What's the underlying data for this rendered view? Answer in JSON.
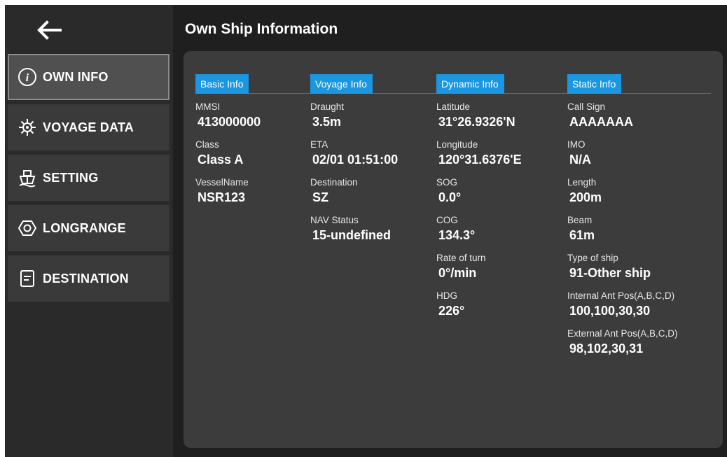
{
  "header": {
    "title": "Own Ship Information"
  },
  "sidebar": {
    "items": [
      {
        "label": "OWN INFO",
        "icon": "info-icon",
        "active": true
      },
      {
        "label": "VOYAGE DATA",
        "icon": "gear-icon",
        "active": false
      },
      {
        "label": "SETTING",
        "icon": "ship-icon",
        "active": false
      },
      {
        "label": "LONGRANGE",
        "icon": "hexagon-icon",
        "active": false
      },
      {
        "label": "DESTINATION",
        "icon": "document-icon",
        "active": false
      }
    ]
  },
  "sections": {
    "basic": {
      "title": "Basic Info",
      "fields": [
        {
          "label": "MMSI",
          "value": "413000000"
        },
        {
          "label": "Class",
          "value": "Class A"
        },
        {
          "label": "VesselName",
          "value": "NSR123"
        }
      ]
    },
    "voyage": {
      "title": "Voyage Info",
      "fields": [
        {
          "label": "Draught",
          "value": "3.5m"
        },
        {
          "label": "ETA",
          "value": "02/01 01:51:00"
        },
        {
          "label": "Destination",
          "value": "SZ"
        },
        {
          "label": "NAV Status",
          "value": "15-undefined"
        }
      ]
    },
    "dynamic": {
      "title": "Dynamic Info",
      "fields": [
        {
          "label": "Latitude",
          "value": "31°26.9326'N"
        },
        {
          "label": "Longitude",
          "value": "120°31.6376'E"
        },
        {
          "label": "SOG",
          "value": "0.0°"
        },
        {
          "label": "COG",
          "value": "134.3°"
        },
        {
          "label": "Rate of turn",
          "value": "0°/min"
        },
        {
          "label": "HDG",
          "value": "226°"
        }
      ]
    },
    "static": {
      "title": "Static Info",
      "fields": [
        {
          "label": "Call Sign",
          "value": "AAAAAAA"
        },
        {
          "label": "IMO",
          "value": "N/A"
        },
        {
          "label": "Length",
          "value": "200m"
        },
        {
          "label": "Beam",
          "value": "61m"
        },
        {
          "label": "Type of ship",
          "value": "91-Other ship"
        },
        {
          "label": "Internal Ant Pos(A,B,C,D)",
          "value": "100,100,30,30"
        },
        {
          "label": "External Ant Pos(A,B,C,D)",
          "value": "98,102,30,31"
        }
      ]
    }
  },
  "colors": {
    "accent": "#1a97e0",
    "background": "#1f1f1f",
    "panel": "#3c3c3c"
  }
}
